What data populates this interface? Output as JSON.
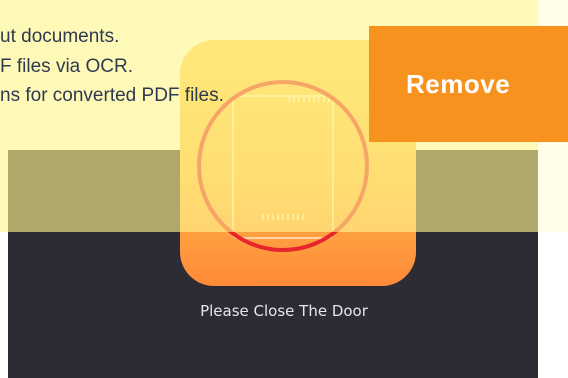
{
  "features": [
    "ut documents.",
    "F files via OCR.",
    "ns for converted PDF files."
  ],
  "remove_button": {
    "label": "Remove"
  },
  "caption": "Please Close The Door",
  "colors": {
    "remove_button": "#f7921e",
    "dark_panel": "#2d2b34",
    "overlay": "#fff58c",
    "ring": "#e8242c"
  },
  "icon": "door-icon"
}
